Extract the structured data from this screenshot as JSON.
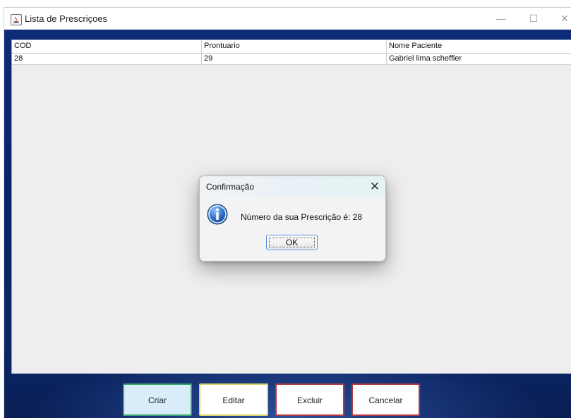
{
  "window": {
    "title": "Lista de Prescriçoes",
    "minimize_glyph": "—",
    "maximize_glyph": "☐",
    "close_glyph": "✕"
  },
  "table": {
    "columns": [
      "COD",
      "Prontuario",
      "Nome Paciente"
    ],
    "rows": [
      [
        "28",
        "29",
        "Gabriel lima scheffler"
      ]
    ]
  },
  "dialog": {
    "title": "Confirmação",
    "message": "Número da sua Prescrição é: 28",
    "ok_label": "OK",
    "close_glyph": "✕",
    "icon": "info-icon"
  },
  "actions": {
    "criar": "Criar",
    "editar": "Editar",
    "excluir": "Excluir",
    "cancelar": "Cancelar"
  },
  "colors": {
    "background_blue": "#0b2667",
    "criar_border": "#3aa66b",
    "editar_border": "#d9d36a",
    "excluir_border": "#b43a46",
    "cancelar_border": "#b43a46",
    "info_icon": "#2f6fc3"
  }
}
